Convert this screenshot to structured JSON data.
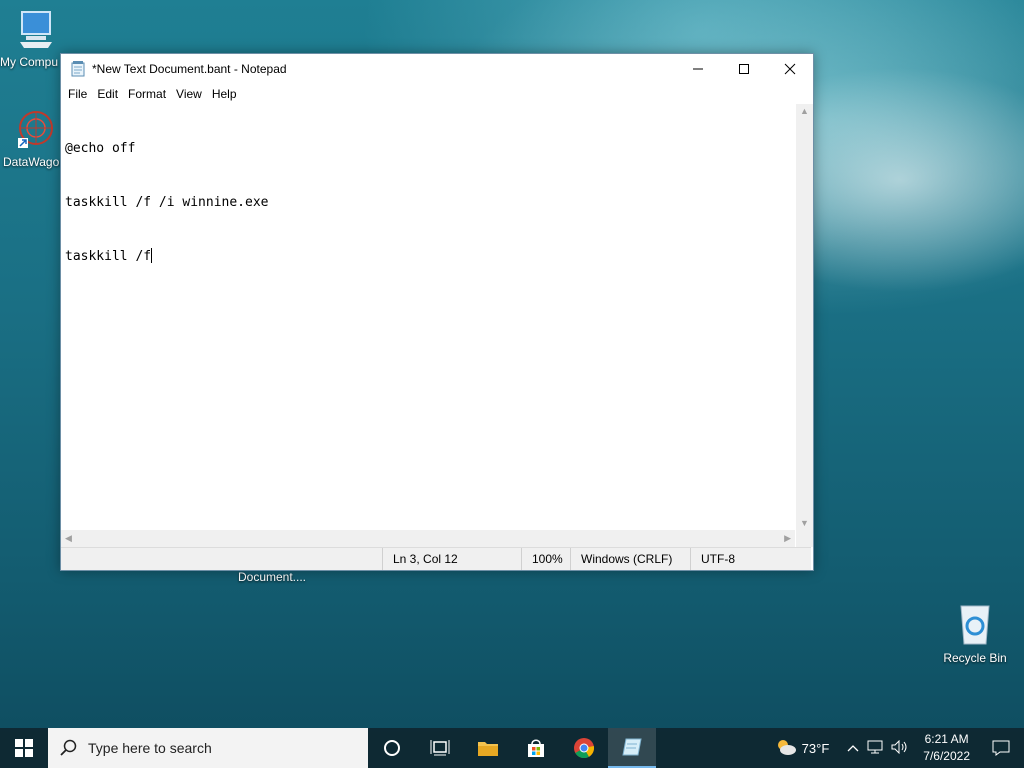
{
  "desktop": {
    "icons": [
      {
        "label": "My Compu"
      },
      {
        "label": "DataWagon"
      },
      {
        "label": "Document...."
      },
      {
        "label": "Recycle Bin"
      }
    ]
  },
  "window": {
    "title": "*New Text Document.bant - Notepad",
    "menu": [
      "File",
      "Edit",
      "Format",
      "View",
      "Help"
    ],
    "content_lines": [
      "@echo off",
      "taskkill /f /i winnine.exe",
      "taskkill /f"
    ],
    "status": {
      "position": "Ln 3, Col 12",
      "zoom": "100%",
      "line_ending": "Windows (CRLF)",
      "encoding": "UTF-8"
    }
  },
  "taskbar": {
    "search_placeholder": "Type here to search",
    "weather": "73°F",
    "time": "6:21 AM",
    "date": "7/6/2022"
  },
  "colors": {
    "accent": "#76b9ed",
    "taskbar": "#0e2630"
  }
}
